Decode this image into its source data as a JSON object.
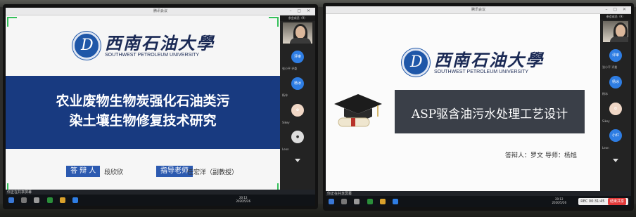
{
  "left_screen": {
    "window_title": "腾讯会议",
    "logo_cn": "西南石油大學",
    "logo_en": "SOUTHWEST PETROLEUM UNIVERSITY",
    "title_line1": "农业废物生物炭强化石油类污",
    "title_line2": "染土壤生物修复技术研究",
    "defender_label": "答 辩 人",
    "defender_name": "段欣欣",
    "advisor_label": "指导老师",
    "advisor_name": "任宏洋（副教授）",
    "status_text": "你正在共享屏幕",
    "panel_header": "参会成员（9）",
    "participants": [
      {
        "initials": "评审",
        "name": "张小平 评委"
      },
      {
        "initials": "杨冰",
        "name": "杨冰"
      },
      {
        "initials": "",
        "name": "Sikey"
      },
      {
        "initials": "",
        "name": "Leon"
      }
    ],
    "taskbar_time": "20:12",
    "taskbar_date": "2020/5/26"
  },
  "right_screen": {
    "window_title": "腾讯会议",
    "logo_cn": "西南石油大學",
    "logo_en": "SOUTHWEST PETROLEUM UNIVERSITY",
    "title": "ASP驱含油污水处理工艺设计",
    "defender": "答辩人：罗文",
    "advisor": "导师：杨旭",
    "status_text": "你正在共享屏幕",
    "panel_header": "参会成员（9）",
    "participants": [
      {
        "initials": "评审",
        "name": "张小平 评委"
      },
      {
        "initials": "杨冰",
        "name": "杨冰"
      },
      {
        "initials": "",
        "name": "Sikey"
      },
      {
        "initials": "小红",
        "name": "Leon"
      }
    ],
    "taskbar_time": "20:12",
    "taskbar_date": "2020/5/26",
    "rec_label": "REC 00:31:45",
    "end_label": "结束共享"
  },
  "colors": {
    "slide1_band": "#183a80",
    "badge": "#2c5ab0",
    "slide2_title_box": "#3a3f48",
    "avatar_blue": "#2e7de3",
    "rec_end": "#e23b3b",
    "frame_green": "#34c05a"
  }
}
